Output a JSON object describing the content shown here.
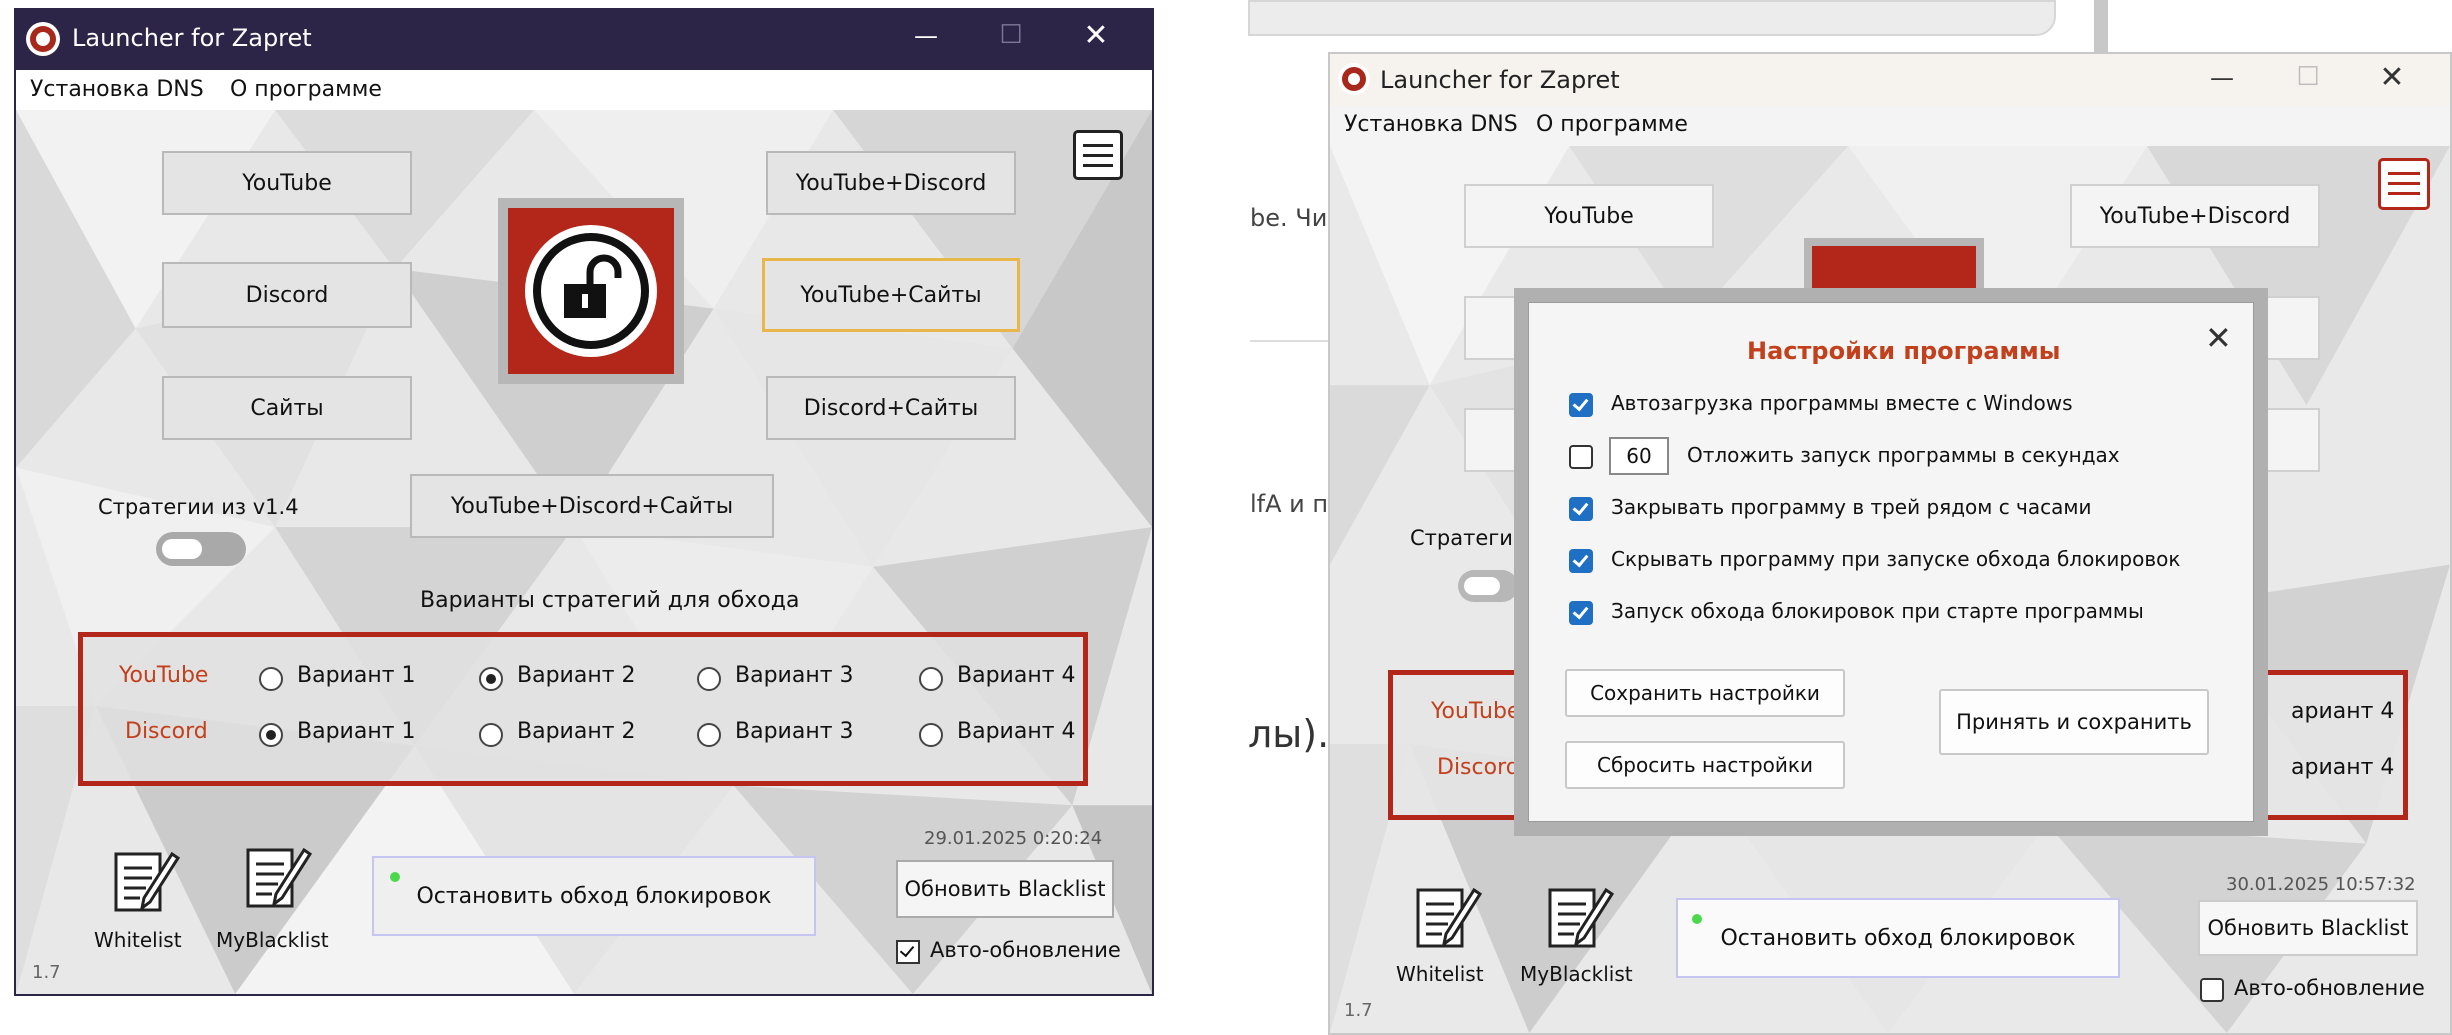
{
  "window": {
    "title": "Launcher for Zapret",
    "minimize": "—",
    "maximize": "☐",
    "close": "✕"
  },
  "menu": {
    "dns": "Установка DNS",
    "about": "О программе"
  },
  "buttons": {
    "youtube": "YouTube",
    "youtube_discord": "YouTube+Discord",
    "discord": "Discord",
    "youtube_sites": "YouTube+Сайты",
    "sites": "Сайты",
    "discord_sites": "Discord+Сайты",
    "all": "YouTube+Discord+Сайты"
  },
  "strategies_label": "Стратегии из v1.4",
  "strategies_label_cut": "Стратеги",
  "variants_title": "Варианты стратегий для обхода",
  "variant_rows": [
    {
      "label": "YouTube",
      "selected": 2
    },
    {
      "label": "Discord",
      "selected": 1
    }
  ],
  "variant_labels": [
    "Вариант 1",
    "Вариант 2",
    "Вариант 3",
    "Вариант 4"
  ],
  "variant_cut": "ариант 4",
  "left": {
    "timestamp": "29.01.2025 0:20:24",
    "auto_update_checked": true
  },
  "right": {
    "timestamp": "30.01.2025 10:57:32",
    "auto_update_checked": false
  },
  "bottom": {
    "whitelist": "Whitelist",
    "myblacklist": "MyBlacklist",
    "stop": "Остановить обход блокировок",
    "update_blacklist": "Обновить Blacklist",
    "auto_update": "Авто-обновление",
    "version": "1.7"
  },
  "background_fragments": {
    "f1": "be. Чи",
    "f2": "lfA и п",
    "f3": "лы)."
  },
  "dialog": {
    "title": "Настройки программы",
    "close": "✕",
    "options": [
      {
        "label": "Автозагрузка программы вместе с Windows",
        "checked": true
      },
      {
        "label": "Отложить запуск программы в секундах",
        "checked": false,
        "value": "60"
      },
      {
        "label": "Закрывать программу в трей рядом с часами",
        "checked": true
      },
      {
        "label": "Скрывать программу при запуске обхода блокировок",
        "checked": true
      },
      {
        "label": "Запуск обхода блокировок при старте программы",
        "checked": true
      }
    ],
    "save": "Сохранить настройки",
    "reset": "Сбросить настройки",
    "apply": "Принять и сохранить"
  },
  "colors": {
    "accent_red": "#b3261a",
    "label_red": "#c2401c",
    "title_dark": "#2c2548",
    "check_blue": "#1f6fc4"
  }
}
